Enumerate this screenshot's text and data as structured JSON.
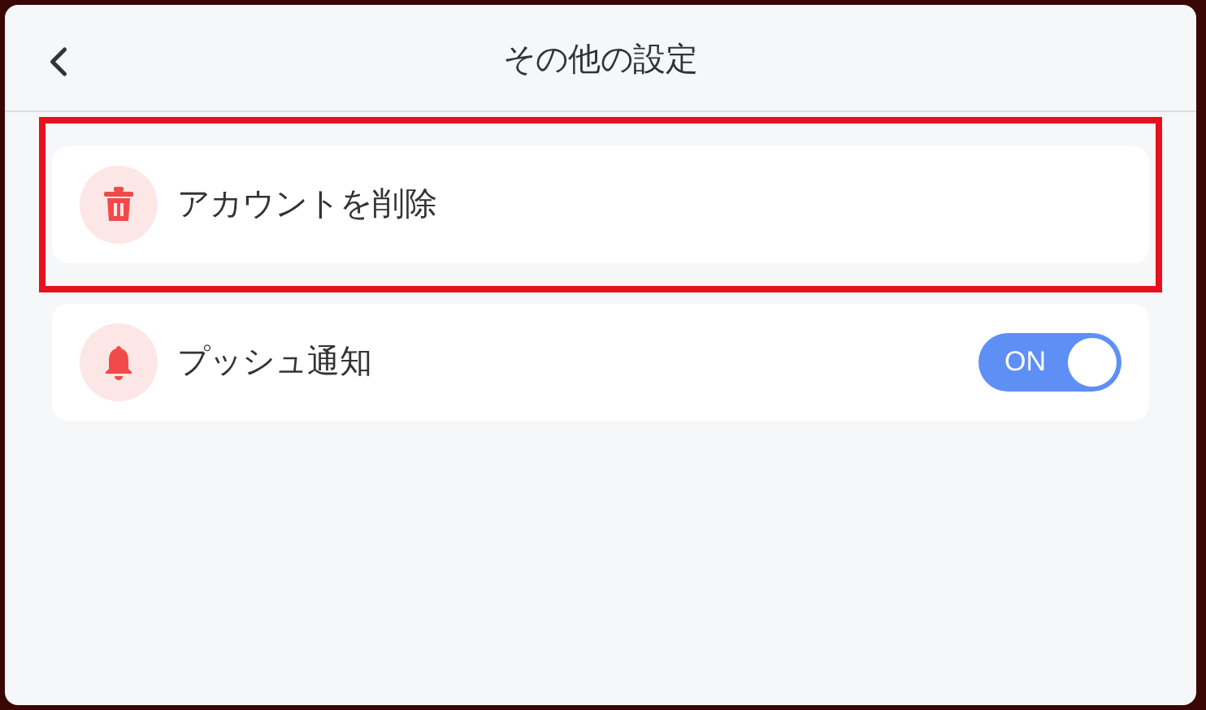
{
  "header": {
    "title": "その他の設定"
  },
  "items": [
    {
      "kind": "action",
      "label": "アカウントを削除",
      "highlighted": true
    },
    {
      "kind": "toggle",
      "label": "プッシュ通知",
      "highlighted": false,
      "on": true,
      "switch_text": "ON"
    }
  ]
}
